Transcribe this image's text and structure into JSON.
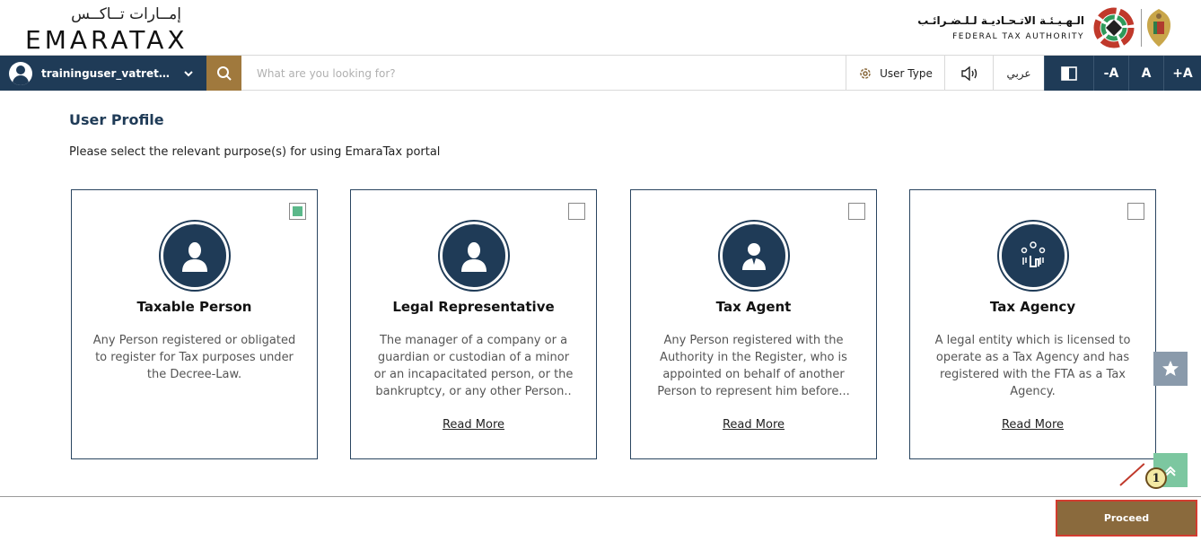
{
  "header": {
    "logo_ar": "إمــارات تــاكــس",
    "logo_en": "EMARATAX",
    "fta_ar": "الـهـيـئـة الاتـحـاديـة لـلـضـرائـب",
    "fta_en": "FEDERAL TAX AUTHORITY"
  },
  "toolbar": {
    "username": "traininguser_vatreturns...",
    "search_placeholder": "What are you looking for?",
    "user_type_label": "User Type",
    "arabic_label": "عربي",
    "font_decrease": "-A",
    "font_normal": "A",
    "font_increase": "+A"
  },
  "page": {
    "title": "User Profile",
    "subtitle": "Please select the relevant purpose(s) for using EmaraTax portal"
  },
  "cards": [
    {
      "title": "Taxable Person",
      "description": "Any Person registered or obligated to register for Tax purposes under the Decree-Law.",
      "read_more": "",
      "checked": true
    },
    {
      "title": "Legal Representative",
      "description": "The manager of a company or a guardian or custodian of a minor or an incapacitated person, or the bankruptcy, or any other Person..",
      "read_more": "Read More",
      "checked": false
    },
    {
      "title": "Tax Agent",
      "description": "Any Person registered with the Authority in the Register, who is appointed on behalf of another Person to represent him before...",
      "read_more": "Read More",
      "checked": false
    },
    {
      "title": "Tax Agency",
      "description": "A legal entity which is licensed to operate as a Tax Agency and has registered with the FTA as a Tax Agency.",
      "read_more": "Read More",
      "checked": false
    }
  ],
  "footer": {
    "proceed_label": "Proceed",
    "callout_number": "1"
  },
  "icons": {
    "search": "search-icon",
    "settings": "gear-icon",
    "audio": "speaker-icon",
    "contrast": "contrast-icon",
    "favorite": "star-icon",
    "scroll_top": "chevron-up-icon"
  },
  "colors": {
    "primary": "#1f3b57",
    "accent_gold": "#a0793d",
    "proceed_bg": "#8a6a3d",
    "check_green": "#5bb88a",
    "highlight_red": "#d23c2f"
  }
}
